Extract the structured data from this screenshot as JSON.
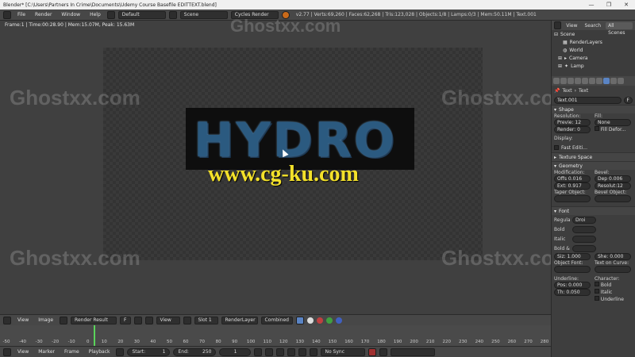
{
  "window": {
    "title": "Blender* [C:\\Users\\Partners In Crime\\Documents\\Udemy Course Basefile EDITTEXT.blend]",
    "controls": [
      "—",
      "❐",
      "✕"
    ]
  },
  "infobar": {
    "menus": [
      "File",
      "Render",
      "Window",
      "Help"
    ],
    "layout": "Default",
    "scene": "Scene",
    "engine": "Cycles Render",
    "stats": "v2.77 | Verts:69,260 | Faces:62,268 | Tris:123,028 | Objects:1/8 | Lamps:0/3 | Mem:50.11M | Text.001"
  },
  "viewport": {
    "frame_info": "Frame:1 | Time:00:28.90 | Mem:15.07M, Peak: 15.63M",
    "render_text": "HYDRO",
    "watermarks": [
      "Ghostxx.com",
      "Ghostxx.com",
      "Ghostxx.com",
      "Ghostxx.com",
      "Ghostxx.com"
    ],
    "site_overlay": "www.cg-ku.com"
  },
  "image_header": {
    "menus": [
      "View",
      "Image"
    ],
    "image": "Render Result",
    "f_label": "F",
    "view_label": "View",
    "slot": "Slot 1",
    "layer": "RenderLayer",
    "pass": "Combined"
  },
  "timeline": {
    "ticks": [
      "-50",
      "-40",
      "-30",
      "-20",
      "-10",
      "0",
      "10",
      "20",
      "30",
      "40",
      "50",
      "60",
      "70",
      "80",
      "90",
      "100",
      "110",
      "120",
      "130",
      "140",
      "150",
      "160",
      "170",
      "180",
      "190",
      "200",
      "210",
      "220",
      "230",
      "240",
      "250",
      "260",
      "270",
      "280"
    ],
    "current_frame_fraction": 0.17
  },
  "timeline_header": {
    "menus": [
      "View",
      "Marker",
      "Frame",
      "Playback"
    ],
    "start": "Start:",
    "start_val": "1",
    "end": "End:",
    "end_val": "250",
    "current": "1",
    "sync": "No Sync"
  },
  "outliner": {
    "tabs": [
      "View",
      "Search",
      "All Scenes"
    ],
    "tree": [
      "Scene",
      "RenderLayers",
      "World",
      "Camera",
      "Lamp"
    ]
  },
  "properties": {
    "breadcrumb": [
      "Text",
      "Text"
    ],
    "datablock": "Text.001",
    "f_label": "F",
    "shape": {
      "header": "Shape",
      "resolution_label": "Resolution:",
      "fill_label": "Fill:",
      "preview": "Previe: 12",
      "render": "Render: 0",
      "fill_mode": "None",
      "fill_deform": "Fill Defor...",
      "display_label": "Display:",
      "fast_edit": "Fast Editi..."
    },
    "texture_space": "Texture Space",
    "geometry": {
      "header": "Geometry",
      "modification_label": "Modification:",
      "bevel_label": "Bevel:",
      "offset": "Offs 0.016",
      "depth": "Dep 0.006",
      "extrude": "Ext: 0.917",
      "resolution": "Resolut:12",
      "taper_label": "Taper Object:",
      "bevel_obj_label": "Bevel Object:"
    },
    "font": {
      "header": "Font",
      "rows": [
        "Regula",
        "Bold",
        "Italic",
        "Bold &"
      ],
      "font_name": "Droi",
      "size": "Siz: 1.000",
      "shear": "She: 0.000",
      "object_font": "Object Font:",
      "text_on_curve": "Text on Curve:"
    },
    "underline": {
      "label": "Underline:",
      "position": "Pos: 0.000",
      "thickness": "Th: 0.050"
    },
    "character": {
      "label": "Character:",
      "options": [
        "Bold",
        "Italic",
        "Underline"
      ]
    }
  }
}
